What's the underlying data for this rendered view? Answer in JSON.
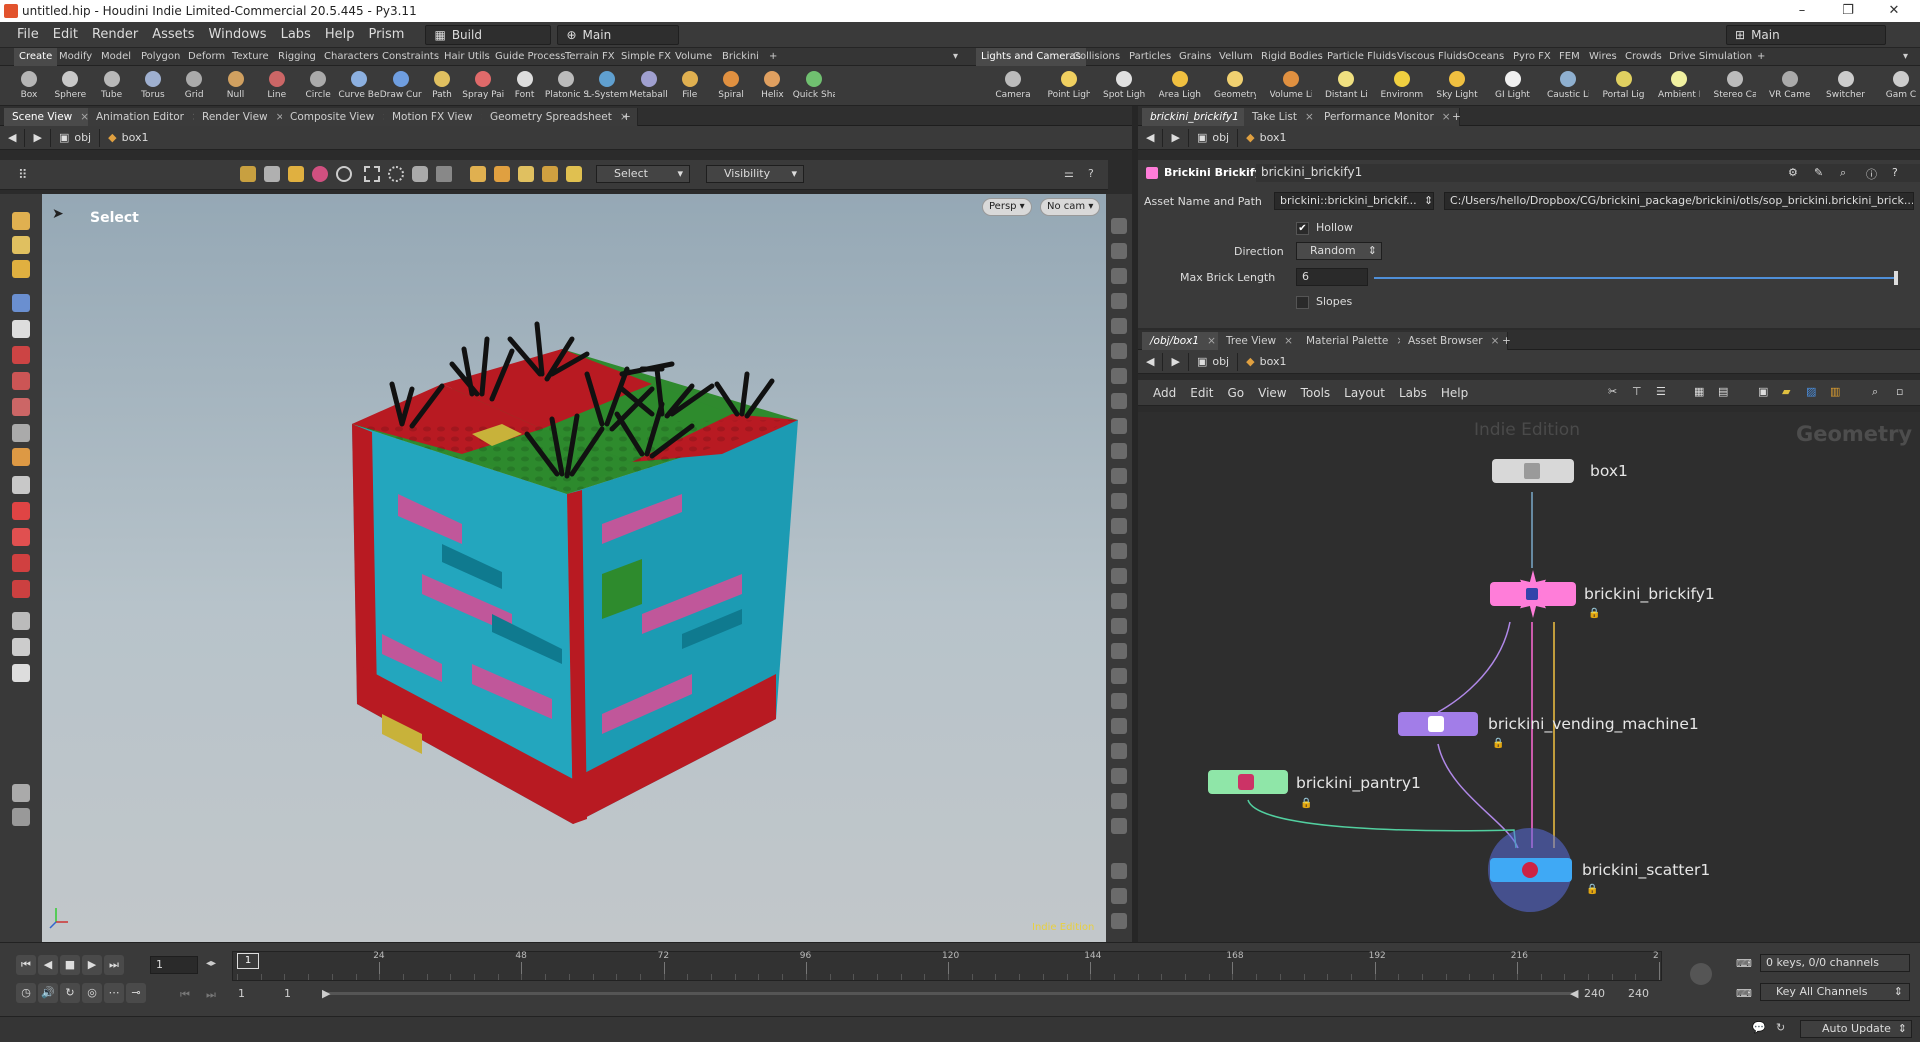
{
  "window": {
    "title": "untitled.hip - Houdini Indie Limited-Commercial 20.5.445 - Py3.11",
    "minimize": "–",
    "restore": "❐",
    "close": "✕"
  },
  "menu": {
    "items": [
      "File",
      "Edit",
      "Render",
      "Assets",
      "Windows",
      "Labs",
      "Help",
      "Prism"
    ],
    "desktop": "Build",
    "context": "Main",
    "right_context": "Main"
  },
  "shelf_tabs_left": [
    "Create",
    "Modify",
    "Model",
    "Polygon",
    "Deform",
    "Texture",
    "Rigging",
    "Characters",
    "Constraints",
    "Hair Utils",
    "Guide Process",
    "Terrain FX",
    "Simple FX",
    "Volume",
    "Brickini"
  ],
  "shelf_tabs_right": [
    "Lights and Cameras",
    "Collisions",
    "Particles",
    "Grains",
    "Vellum",
    "Rigid Bodies",
    "Particle Fluids",
    "Viscous Fluids",
    "Oceans",
    "Pyro FX",
    "FEM",
    "Wires",
    "Crowds",
    "Drive Simulation"
  ],
  "shelf_tools_left": [
    {
      "label": "Box",
      "color": "#b5b5b5"
    },
    {
      "label": "Sphere",
      "color": "#c8c8c8"
    },
    {
      "label": "Tube",
      "color": "#b8b8b8"
    },
    {
      "label": "Torus",
      "color": "#9fb0d0"
    },
    {
      "label": "Grid",
      "color": "#aaaaaa"
    },
    {
      "label": "Null",
      "color": "#d0a060"
    },
    {
      "label": "Line",
      "color": "#cc6666"
    },
    {
      "label": "Circle",
      "color": "#aaaaaa"
    },
    {
      "label": "Curve Bezier",
      "color": "#8cb0e0"
    },
    {
      "label": "Draw Curve",
      "color": "#6f9ee0"
    },
    {
      "label": "Path",
      "color": "#e0c060"
    },
    {
      "label": "Spray Paint",
      "color": "#e06a6a"
    },
    {
      "label": "Font",
      "color": "#dddddd"
    },
    {
      "label": "Platonic Solids",
      "color": "#bbbbbb"
    },
    {
      "label": "L-System",
      "color": "#60a0d0"
    },
    {
      "label": "Metaball",
      "color": "#a0a0d0"
    },
    {
      "label": "File",
      "color": "#e0b050"
    },
    {
      "label": "Spiral",
      "color": "#e09040"
    },
    {
      "label": "Helix",
      "color": "#e0a060"
    },
    {
      "label": "Quick Shapes",
      "color": "#70c070"
    }
  ],
  "shelf_tools_right": [
    {
      "label": "Camera",
      "color": "#bbbbbb"
    },
    {
      "label": "Point Light",
      "color": "#f0d060"
    },
    {
      "label": "Spot Light",
      "color": "#e0e0e0"
    },
    {
      "label": "Area Light",
      "color": "#f0c040"
    },
    {
      "label": "Geometry Light",
      "color": "#f0d070"
    },
    {
      "label": "Volume Light",
      "color": "#e09040"
    },
    {
      "label": "Distant Light",
      "color": "#f0e080"
    },
    {
      "label": "Environment Light",
      "color": "#f0d040"
    },
    {
      "label": "Sky Light",
      "color": "#f0c040"
    },
    {
      "label": "GI Light",
      "color": "#f0f0f0"
    },
    {
      "label": "Caustic Light",
      "color": "#8fb0d0"
    },
    {
      "label": "Portal Light",
      "color": "#e0d060"
    },
    {
      "label": "Ambient Light",
      "color": "#f0f0a0"
    },
    {
      "label": "Stereo Camera",
      "color": "#bbbbbb"
    },
    {
      "label": "VR Camera",
      "color": "#aaaaaa"
    },
    {
      "label": "Switcher",
      "color": "#cccccc"
    },
    {
      "label": "Gam C",
      "color": "#cccccc"
    }
  ],
  "left_pane_tabs": [
    "Scene View",
    "Animation Editor",
    "Render View",
    "Composite View",
    "Motion FX View",
    "Geometry Spreadsheet"
  ],
  "left_path": {
    "root": "obj",
    "node": "box1"
  },
  "viewport": {
    "select_dropdown": "Select",
    "visibility_dropdown": "Visibility",
    "state_label": "Select",
    "persp": "Persp ▾",
    "nocam": "No cam ▾",
    "watermark": "Indie Edition"
  },
  "right_top_tabs": [
    "brickini_brickify1",
    "Take List",
    "Performance Monitor"
  ],
  "right_path": {
    "root": "obj",
    "node": "box1"
  },
  "params": {
    "node_type": "Brickini Brickify",
    "node_name": "brickini_brickify1",
    "asset_label": "Asset Name and Path",
    "asset_name": "brickini::brickini_brickif...",
    "asset_path": "C:/Users/hello/Dropbox/CG/brickini_package/brickini/otls/sop_brickini.brickini_brick...",
    "hollow_label": "Hollow",
    "hollow_check": "✔",
    "direction_label": "Direction",
    "direction_value": "Random",
    "max_brick_label": "Max Brick Length",
    "max_brick_value": "6",
    "max_brick_fraction": 1.0,
    "slopes_label": "Slopes"
  },
  "net_tabs": [
    "/obj/box1",
    "Tree View",
    "Material Palette",
    "Asset Browser"
  ],
  "net_path": {
    "root": "obj",
    "node": "box1"
  },
  "net_menu": [
    "Add",
    "Edit",
    "Go",
    "View",
    "Tools",
    "Layout",
    "Labs",
    "Help"
  ],
  "net": {
    "watermark": "Indie Edition",
    "context_label": "Geometry",
    "nodes": [
      {
        "name": "box1",
        "color": "#d8d8d8"
      },
      {
        "name": "brickini_brickify1",
        "color": "#ff7dd9"
      },
      {
        "name": "brickini_vending_machine1",
        "color": "#a27de8"
      },
      {
        "name": "brickini_pantry1",
        "color": "#8fe6a8"
      },
      {
        "name": "brickini_scatter1",
        "color": "#3fa9f5"
      }
    ]
  },
  "timeline": {
    "ticks": [
      "24",
      "48",
      "72",
      "96",
      "120",
      "144",
      "168",
      "192",
      "216",
      "2"
    ],
    "current_marker": "1",
    "frame": "1",
    "range_start": "1",
    "range_start2": "1",
    "range_end": "240",
    "range_end2": "240",
    "keys_info": "0 keys, 0/0 channels",
    "key_channels": "Key All Channels",
    "auto_update": "Auto Update"
  }
}
